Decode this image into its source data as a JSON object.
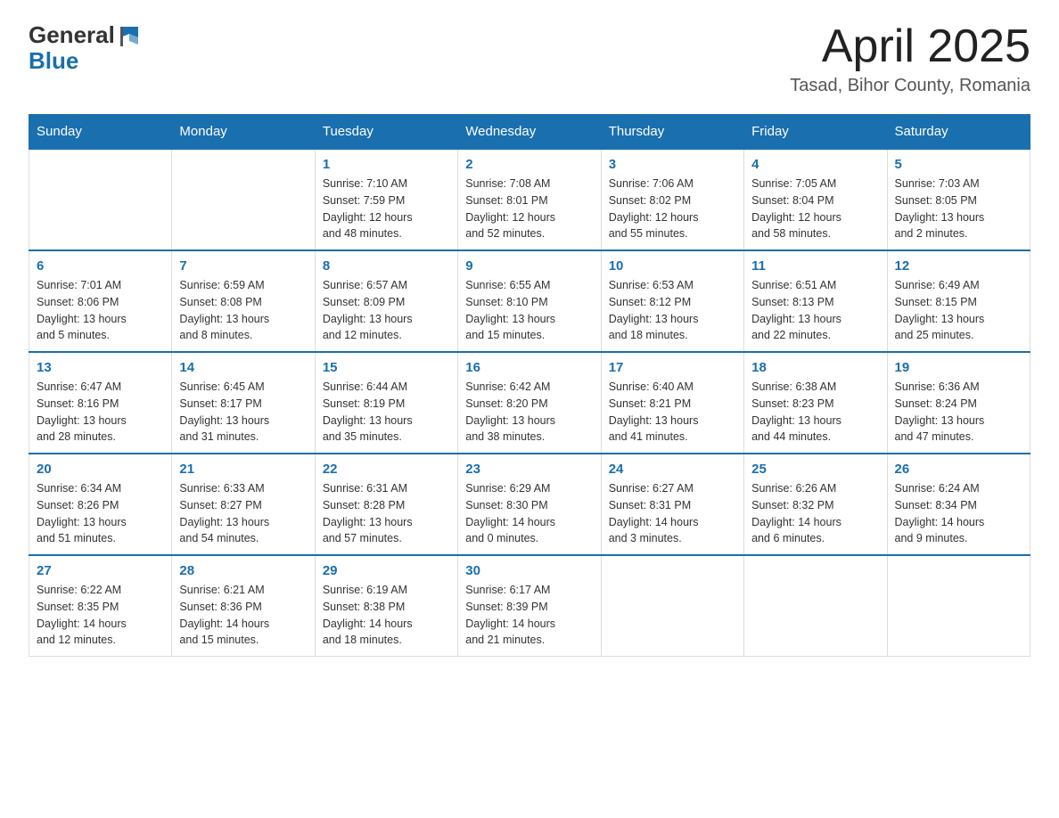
{
  "header": {
    "logo_general": "General",
    "logo_blue": "Blue",
    "month_title": "April 2025",
    "location": "Tasad, Bihor County, Romania"
  },
  "calendar": {
    "days_of_week": [
      "Sunday",
      "Monday",
      "Tuesday",
      "Wednesday",
      "Thursday",
      "Friday",
      "Saturday"
    ],
    "weeks": [
      [
        {
          "day": "",
          "info": ""
        },
        {
          "day": "",
          "info": ""
        },
        {
          "day": "1",
          "info": "Sunrise: 7:10 AM\nSunset: 7:59 PM\nDaylight: 12 hours\nand 48 minutes."
        },
        {
          "day": "2",
          "info": "Sunrise: 7:08 AM\nSunset: 8:01 PM\nDaylight: 12 hours\nand 52 minutes."
        },
        {
          "day": "3",
          "info": "Sunrise: 7:06 AM\nSunset: 8:02 PM\nDaylight: 12 hours\nand 55 minutes."
        },
        {
          "day": "4",
          "info": "Sunrise: 7:05 AM\nSunset: 8:04 PM\nDaylight: 12 hours\nand 58 minutes."
        },
        {
          "day": "5",
          "info": "Sunrise: 7:03 AM\nSunset: 8:05 PM\nDaylight: 13 hours\nand 2 minutes."
        }
      ],
      [
        {
          "day": "6",
          "info": "Sunrise: 7:01 AM\nSunset: 8:06 PM\nDaylight: 13 hours\nand 5 minutes."
        },
        {
          "day": "7",
          "info": "Sunrise: 6:59 AM\nSunset: 8:08 PM\nDaylight: 13 hours\nand 8 minutes."
        },
        {
          "day": "8",
          "info": "Sunrise: 6:57 AM\nSunset: 8:09 PM\nDaylight: 13 hours\nand 12 minutes."
        },
        {
          "day": "9",
          "info": "Sunrise: 6:55 AM\nSunset: 8:10 PM\nDaylight: 13 hours\nand 15 minutes."
        },
        {
          "day": "10",
          "info": "Sunrise: 6:53 AM\nSunset: 8:12 PM\nDaylight: 13 hours\nand 18 minutes."
        },
        {
          "day": "11",
          "info": "Sunrise: 6:51 AM\nSunset: 8:13 PM\nDaylight: 13 hours\nand 22 minutes."
        },
        {
          "day": "12",
          "info": "Sunrise: 6:49 AM\nSunset: 8:15 PM\nDaylight: 13 hours\nand 25 minutes."
        }
      ],
      [
        {
          "day": "13",
          "info": "Sunrise: 6:47 AM\nSunset: 8:16 PM\nDaylight: 13 hours\nand 28 minutes."
        },
        {
          "day": "14",
          "info": "Sunrise: 6:45 AM\nSunset: 8:17 PM\nDaylight: 13 hours\nand 31 minutes."
        },
        {
          "day": "15",
          "info": "Sunrise: 6:44 AM\nSunset: 8:19 PM\nDaylight: 13 hours\nand 35 minutes."
        },
        {
          "day": "16",
          "info": "Sunrise: 6:42 AM\nSunset: 8:20 PM\nDaylight: 13 hours\nand 38 minutes."
        },
        {
          "day": "17",
          "info": "Sunrise: 6:40 AM\nSunset: 8:21 PM\nDaylight: 13 hours\nand 41 minutes."
        },
        {
          "day": "18",
          "info": "Sunrise: 6:38 AM\nSunset: 8:23 PM\nDaylight: 13 hours\nand 44 minutes."
        },
        {
          "day": "19",
          "info": "Sunrise: 6:36 AM\nSunset: 8:24 PM\nDaylight: 13 hours\nand 47 minutes."
        }
      ],
      [
        {
          "day": "20",
          "info": "Sunrise: 6:34 AM\nSunset: 8:26 PM\nDaylight: 13 hours\nand 51 minutes."
        },
        {
          "day": "21",
          "info": "Sunrise: 6:33 AM\nSunset: 8:27 PM\nDaylight: 13 hours\nand 54 minutes."
        },
        {
          "day": "22",
          "info": "Sunrise: 6:31 AM\nSunset: 8:28 PM\nDaylight: 13 hours\nand 57 minutes."
        },
        {
          "day": "23",
          "info": "Sunrise: 6:29 AM\nSunset: 8:30 PM\nDaylight: 14 hours\nand 0 minutes."
        },
        {
          "day": "24",
          "info": "Sunrise: 6:27 AM\nSunset: 8:31 PM\nDaylight: 14 hours\nand 3 minutes."
        },
        {
          "day": "25",
          "info": "Sunrise: 6:26 AM\nSunset: 8:32 PM\nDaylight: 14 hours\nand 6 minutes."
        },
        {
          "day": "26",
          "info": "Sunrise: 6:24 AM\nSunset: 8:34 PM\nDaylight: 14 hours\nand 9 minutes."
        }
      ],
      [
        {
          "day": "27",
          "info": "Sunrise: 6:22 AM\nSunset: 8:35 PM\nDaylight: 14 hours\nand 12 minutes."
        },
        {
          "day": "28",
          "info": "Sunrise: 6:21 AM\nSunset: 8:36 PM\nDaylight: 14 hours\nand 15 minutes."
        },
        {
          "day": "29",
          "info": "Sunrise: 6:19 AM\nSunset: 8:38 PM\nDaylight: 14 hours\nand 18 minutes."
        },
        {
          "day": "30",
          "info": "Sunrise: 6:17 AM\nSunset: 8:39 PM\nDaylight: 14 hours\nand 21 minutes."
        },
        {
          "day": "",
          "info": ""
        },
        {
          "day": "",
          "info": ""
        },
        {
          "day": "",
          "info": ""
        }
      ]
    ]
  }
}
